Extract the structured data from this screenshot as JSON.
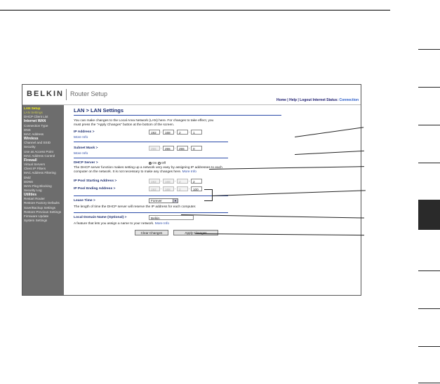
{
  "header": {
    "logo": "BELKIN",
    "app_title": "Router Setup",
    "links": "Home | Help | Logout   Internet Status:",
    "status": "Connection"
  },
  "sidebar": [
    {
      "label": "LAN Setup",
      "style": "sel"
    },
    {
      "label": "LAN Settings",
      "style": "dim"
    },
    {
      "label": "DHCP Client List",
      "style": ""
    },
    {
      "label": "Internet WAN",
      "style": "head"
    },
    {
      "label": "Connection Type",
      "style": ""
    },
    {
      "label": "DNS",
      "style": ""
    },
    {
      "label": "MAC Address",
      "style": ""
    },
    {
      "label": "Wireless",
      "style": "head"
    },
    {
      "label": "Channel and SSID",
      "style": ""
    },
    {
      "label": "Security",
      "style": ""
    },
    {
      "label": "Use as Access Point",
      "style": ""
    },
    {
      "label": "MAC Address Control",
      "style": ""
    },
    {
      "label": "Firewall",
      "style": "head"
    },
    {
      "label": "Virtual Servers",
      "style": ""
    },
    {
      "label": "Client IP Filters",
      "style": ""
    },
    {
      "label": "MAC Address Filtering",
      "style": ""
    },
    {
      "label": "DMZ",
      "style": ""
    },
    {
      "label": "DDNS",
      "style": ""
    },
    {
      "label": "WAN Ping Blocking",
      "style": ""
    },
    {
      "label": "Security Log",
      "style": ""
    },
    {
      "label": "Utilities",
      "style": "head"
    },
    {
      "label": "Restart Router",
      "style": ""
    },
    {
      "label": "Restore Factory Defaults",
      "style": ""
    },
    {
      "label": "Save/Backup Settings",
      "style": ""
    },
    {
      "label": "Restore Previous Settings",
      "style": ""
    },
    {
      "label": "Firmware Update",
      "style": ""
    },
    {
      "label": "System Settings",
      "style": ""
    }
  ],
  "main": {
    "heading": "LAN > LAN Settings",
    "intro": "You can make changes to the Local Area Network (LAN) here. For changes to take effect, you must press the \"Apply Changes\" button at the bottom of the screen.",
    "ip_label": "IP Address >",
    "ip": [
      "192",
      "168",
      "2",
      "1"
    ],
    "more_info": "More Info",
    "subnet_label": "Subnet Mask >",
    "subnet": [
      "255",
      "255",
      "255",
      "0"
    ],
    "dhcp_label": "DHCP Server >",
    "dhcp_on": "On",
    "dhcp_off": "Off",
    "dhcp_text": "The DHCP server function makes setting up a network very easy by assigning IP addresses to each computer on the network. It is not necessary to make any changes here.",
    "pool_start_label": "IP Pool Starting Address >",
    "pool_start": [
      "192",
      "168",
      "2",
      "2"
    ],
    "pool_end_label": "IP Pool Ending Address >",
    "pool_end": [
      "192",
      "168",
      "2",
      "100"
    ],
    "lease_label": "Lease Time >",
    "lease_value": "Forever",
    "lease_text": "The length of time the DHCP server will reserve the IP address for each computer.",
    "domain_label": "Local Domain Name (Optional) >",
    "domain_value": "Belkin",
    "domain_text": "A feature that lets you assign a name to your network.",
    "clear_btn": "Clear Changes",
    "apply_btn": "Apply Changes"
  }
}
